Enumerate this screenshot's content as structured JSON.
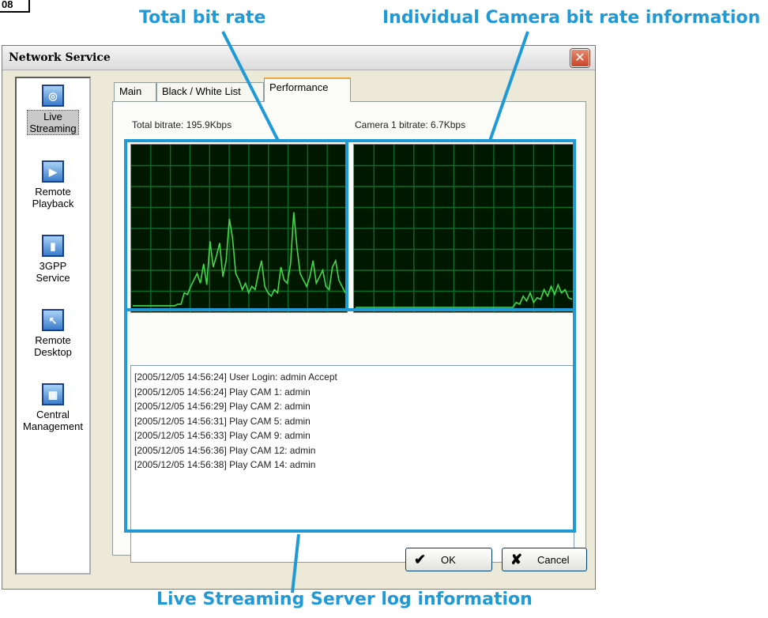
{
  "corner_tag": "08",
  "callouts": {
    "total_bit_rate": "Total bit rate",
    "camera_bit_rate": "Individual Camera bit rate information",
    "log_info": "Live Streaming Server log information"
  },
  "window": {
    "title": "Network Service",
    "close_glyph": "✕"
  },
  "sidebar": {
    "items": [
      {
        "label_line1": "Live",
        "label_line2": "Streaming",
        "icon": "monitor-icon",
        "glyph": "◎",
        "selected": true
      },
      {
        "label_line1": "Remote",
        "label_line2": "Playback",
        "icon": "play-icon",
        "glyph": "▶",
        "selected": false
      },
      {
        "label_line1": "3GPP",
        "label_line2": "Service",
        "icon": "phone-icon",
        "glyph": "▮",
        "selected": false
      },
      {
        "label_line1": "Remote",
        "label_line2": "Desktop",
        "icon": "remote-desktop-icon",
        "glyph": "↖",
        "selected": false
      },
      {
        "label_line1": "Central",
        "label_line2": "Management",
        "icon": "management-icon",
        "glyph": "▦",
        "selected": false
      }
    ]
  },
  "tabs": [
    {
      "label": "Main",
      "active": false
    },
    {
      "label": "Black / White List",
      "active": false
    },
    {
      "label": "Performance",
      "active": true
    }
  ],
  "performance": {
    "total_bitrate_label": "Total bitrate: 195.9Kbps",
    "camera_bitrate_label": "Camera 1 bitrate: 6.7Kbps",
    "graph_colors": {
      "background": "#001800",
      "grid": "#0c6a2a",
      "trace": "#46d84a"
    },
    "total_trace": [
      0.02,
      0.02,
      0.02,
      0.02,
      0.02,
      0.02,
      0.02,
      0.02,
      0.02,
      0.02,
      0.02,
      0.02,
      0.02,
      0.02,
      0.03,
      0.03,
      0.1,
      0.09,
      0.14,
      0.18,
      0.22,
      0.16,
      0.28,
      0.15,
      0.42,
      0.26,
      0.33,
      0.41,
      0.2,
      0.3,
      0.56,
      0.44,
      0.22,
      0.18,
      0.12,
      0.16,
      0.1,
      0.14,
      0.12,
      0.22,
      0.3,
      0.14,
      0.1,
      0.08,
      0.12,
      0.1,
      0.26,
      0.18,
      0.16,
      0.28,
      0.6,
      0.38,
      0.22,
      0.18,
      0.14,
      0.2,
      0.3,
      0.16,
      0.2,
      0.24,
      0.14,
      0.12,
      0.26,
      0.3,
      0.18,
      0.14,
      0.1
    ],
    "camera_trace": [
      0.01,
      0.01,
      0.01,
      0.01,
      0.01,
      0.01,
      0.01,
      0.01,
      0.01,
      0.01,
      0.01,
      0.01,
      0.01,
      0.01,
      0.01,
      0.01,
      0.01,
      0.01,
      0.01,
      0.01,
      0.01,
      0.01,
      0.01,
      0.01,
      0.01,
      0.01,
      0.01,
      0.01,
      0.01,
      0.01,
      0.01,
      0.01,
      0.01,
      0.01,
      0.01,
      0.01,
      0.01,
      0.01,
      0.01,
      0.01,
      0.01,
      0.01,
      0.01,
      0.01,
      0.01,
      0.01,
      0.04,
      0.03,
      0.08,
      0.05,
      0.1,
      0.04,
      0.07,
      0.06,
      0.12,
      0.08,
      0.14,
      0.09,
      0.15,
      0.1,
      0.12,
      0.07,
      0.06
    ]
  },
  "log_lines": [
    "[2005/12/05 14:56:24]  User Login: admin Accept",
    "[2005/12/05 14:56:24]  Play CAM 1: admin",
    "[2005/12/05 14:56:29]  Play CAM 2: admin",
    "[2005/12/05 14:56:31]  Play CAM 5: admin",
    "[2005/12/05 14:56:33]  Play CAM 9: admin",
    "[2005/12/05 14:56:36]  Play CAM 12: admin",
    "[2005/12/05 14:56:38]  Play CAM 14: admin"
  ],
  "buttons": {
    "ok_label": "OK",
    "ok_glyph": "✔",
    "cancel_label": "Cancel",
    "cancel_glyph": "✘"
  }
}
